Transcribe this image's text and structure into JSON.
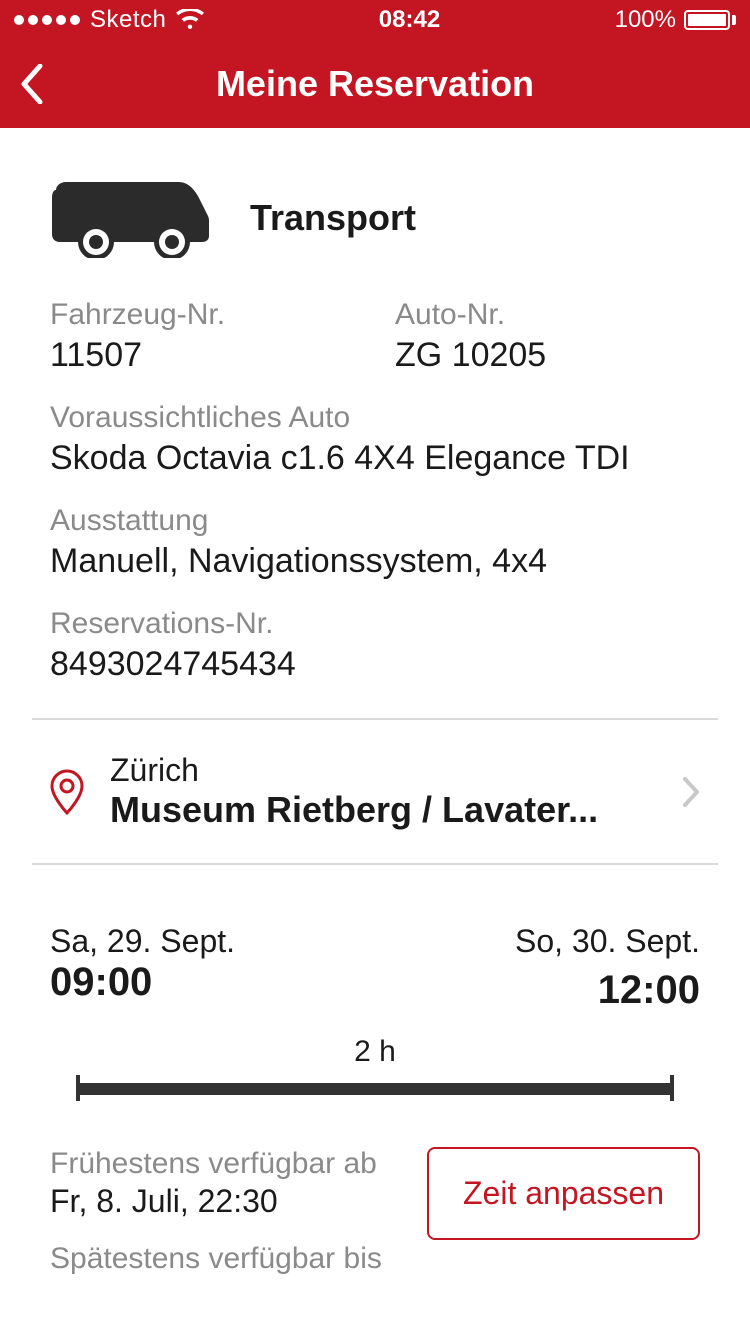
{
  "status": {
    "carrier": "Sketch",
    "time": "08:42",
    "battery_pct": "100%"
  },
  "nav": {
    "title": "Meine Reservation"
  },
  "category": {
    "title": "Transport"
  },
  "fields": {
    "vehicle_nr_label": "Fahrzeug-Nr.",
    "vehicle_nr_value": "11507",
    "auto_nr_label": "Auto-Nr.",
    "auto_nr_value": "ZG 10205",
    "expected_car_label": "Voraussichtliches Auto",
    "expected_car_value": "Skoda Octavia c1.6 4X4 Elegance TDI",
    "equipment_label": "Ausstattung",
    "equipment_value": "Manuell, Navigationssystem, 4x4",
    "reservation_nr_label": "Reservations-Nr.",
    "reservation_nr_value": "8493024745434"
  },
  "location": {
    "city": "Zürich",
    "name": "Museum Rietberg / Lavater..."
  },
  "times": {
    "start_date": "Sa, 29. Sept.",
    "start_time": "09:00",
    "end_date": "So, 30. Sept.",
    "end_time": "12:00",
    "duration": "2 h"
  },
  "availability": {
    "earliest_label": "Frühestens verfügbar ab",
    "earliest_value": "Fr, 8. Juli, 22:30",
    "latest_label": "Spätestens verfügbar bis",
    "adjust_button": "Zeit anpassen"
  }
}
